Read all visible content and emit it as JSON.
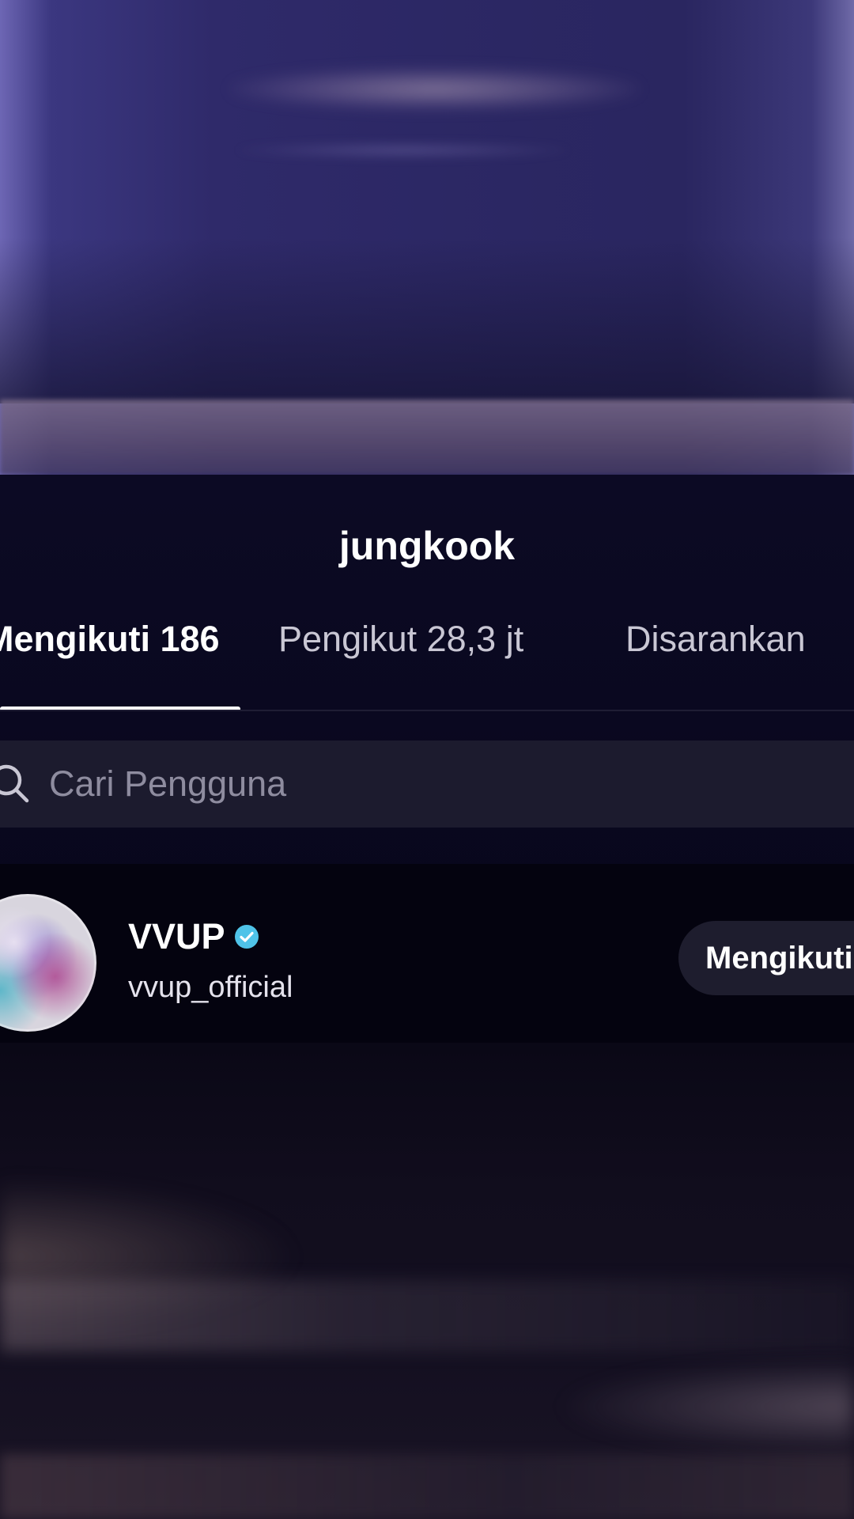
{
  "sheet": {
    "title": "jungkook"
  },
  "tabs": [
    {
      "label": "Mengikuti 186",
      "active": true
    },
    {
      "label": "Pengikut 28,3 jt",
      "active": false
    },
    {
      "label": "Disarankan",
      "active": false
    }
  ],
  "search": {
    "placeholder": "Cari Pengguna",
    "icon": "search-icon"
  },
  "users": [
    {
      "name": "VVUP",
      "handle": "vvup_official",
      "verified": true,
      "button_label": "Mengikuti"
    }
  ],
  "colors": {
    "sheet_background": "#07061a",
    "search_background": "#1c1b2e",
    "verified_badge": "#4fc3e8",
    "button_background": "#1e1d2e",
    "active_tab_text": "#ffffff",
    "inactive_tab_text": "#c9c7d4"
  }
}
